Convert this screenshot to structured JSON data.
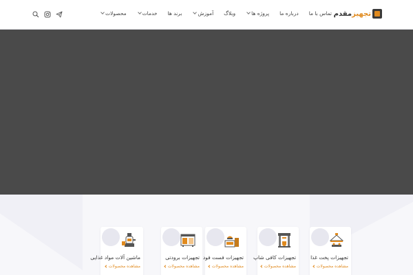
{
  "header": {
    "logo": {
      "text_dark": "مقدم",
      "text_accent": "تجهیز"
    },
    "nav": [
      {
        "label": "محصولات",
        "dropdown": true
      },
      {
        "label": "خدمات",
        "dropdown": true
      },
      {
        "label": "برند ها",
        "dropdown": false
      },
      {
        "label": "آموزش",
        "dropdown": true
      },
      {
        "label": "وبلاگ",
        "dropdown": false
      },
      {
        "label": "پروژه ها",
        "dropdown": true
      },
      {
        "label": "درباره ما",
        "dropdown": false
      },
      {
        "label": "تماس با ما",
        "dropdown": false
      }
    ],
    "icons": [
      "send-icon",
      "instagram-icon",
      "search-icon"
    ]
  },
  "categories": [
    {
      "title": "تجهیزات پخت غذا",
      "link": "مشاهده محصولات",
      "icon": "cooking-hood-icon"
    },
    {
      "title": "تجهیزات کافی شاپ",
      "link": "مشاهده محصولات",
      "icon": "espresso-machine-icon"
    },
    {
      "title": "تجهیزات فست فود",
      "link": "مشاهده محصولات",
      "icon": "fast-food-icon"
    },
    {
      "title": "تجهیزات برودتی",
      "link": "مشاهده محصولات",
      "icon": "refrigerator-icon"
    },
    {
      "title": "ماشین آلات مواد غذایی",
      "link": "مشاهده محصولات",
      "icon": "food-processor-icon"
    }
  ],
  "colors": {
    "accent": "#e08a1e",
    "hero": "#4a4a4a",
    "section_bg": "#f7f7fa"
  }
}
